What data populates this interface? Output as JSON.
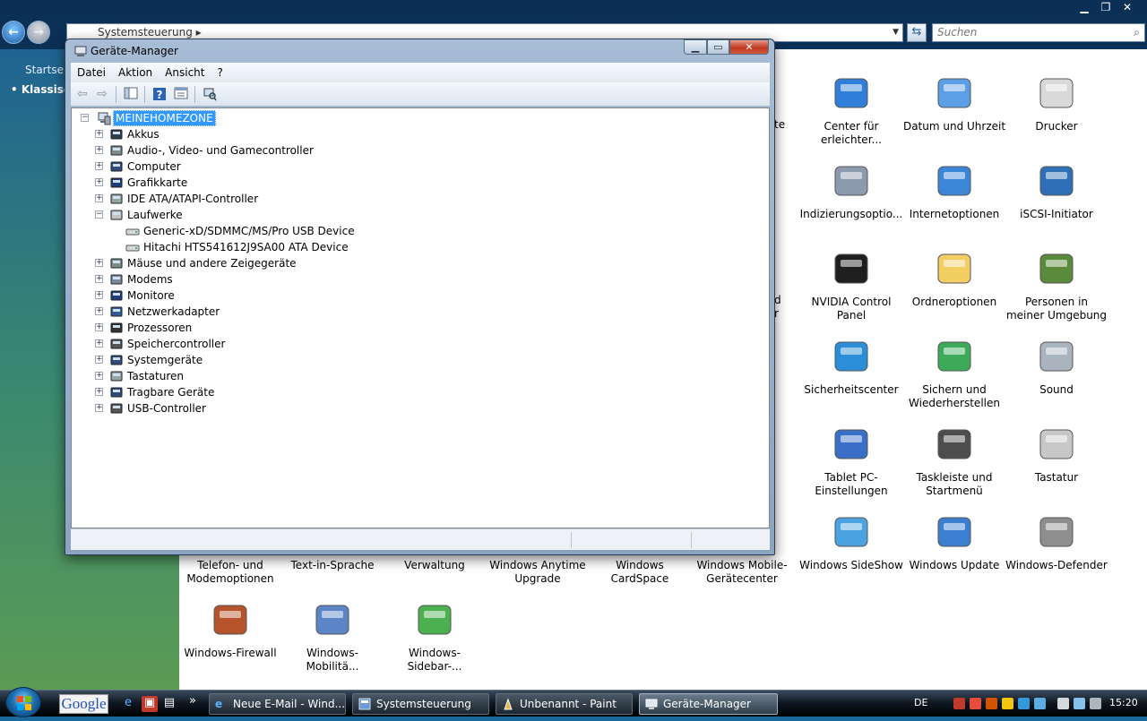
{
  "control_panel": {
    "breadcrumb": "Systemsteuerung",
    "search_placeholder": "Suchen",
    "sidebar": {
      "start": "Startseit",
      "classic": "Klassisc"
    },
    "items": [
      {
        "label": "Center für erleichter...",
        "icon": "accessibility-icon"
      },
      {
        "label": "Datum und Uhrzeit",
        "icon": "calendar-clock-icon"
      },
      {
        "label": "Drucker",
        "icon": "printer-icon"
      },
      {
        "label": "Indizierungsoptio...",
        "icon": "indexing-icon"
      },
      {
        "label": "Internetoptionen",
        "icon": "globe-icon"
      },
      {
        "label": "iSCSI-Initiator",
        "icon": "iscsi-icon"
      },
      {
        "label": "NVIDIA Control Panel",
        "icon": "nvidia-icon"
      },
      {
        "label": "Ordneroptionen",
        "icon": "folder-options-icon"
      },
      {
        "label": "Personen in meiner Umgebung",
        "icon": "people-icon"
      },
      {
        "label": "Sicherheitscenter",
        "icon": "shield-icon"
      },
      {
        "label": "Sichern und Wiederherstellen",
        "icon": "backup-icon"
      },
      {
        "label": "Sound",
        "icon": "speaker-icon"
      },
      {
        "label": "Tablet PC-Einstellungen",
        "icon": "tablet-icon"
      },
      {
        "label": "Taskleiste und Startmenü",
        "icon": "taskbar-icon"
      },
      {
        "label": "Tastatur",
        "icon": "keyboard-icon"
      },
      {
        "label": "Telefon- und Modemoptionen",
        "icon": "phone-icon"
      },
      {
        "label": "Text-in-Sprache",
        "icon": "speech-icon"
      },
      {
        "label": "Verwaltung",
        "icon": "admin-icon"
      },
      {
        "label": "Windows Anytime Upgrade",
        "icon": "upgrade-icon"
      },
      {
        "label": "Windows CardSpace",
        "icon": "cardspace-icon"
      },
      {
        "label": "Windows Mobile-Gerätecenter",
        "icon": "mobile-icon"
      },
      {
        "label": "Windows SideShow",
        "icon": "sideshow-icon"
      },
      {
        "label": "Windows Update",
        "icon": "update-icon"
      },
      {
        "label": "Windows-Defender",
        "icon": "defender-icon"
      },
      {
        "label": "Windows-Firewall",
        "icon": "firewall-icon"
      },
      {
        "label": "Windows-Mobilitä...",
        "icon": "mobility-icon"
      },
      {
        "label": "Windows-Sidebar-...",
        "icon": "sidebar-icon"
      }
    ],
    "partial_labels": [
      "te",
      "d",
      "r"
    ]
  },
  "device_manager": {
    "title": "Geräte-Manager",
    "menu": [
      "Datei",
      "Aktion",
      "Ansicht",
      "?"
    ],
    "root": "MEINEHOMEZONE",
    "categories": [
      {
        "label": "Akkus",
        "icon": "battery-icon",
        "expanded": false
      },
      {
        "label": "Audio-, Video- und Gamecontroller",
        "icon": "audio-icon",
        "expanded": false
      },
      {
        "label": "Computer",
        "icon": "computer-icon",
        "expanded": false
      },
      {
        "label": "Grafikkarte",
        "icon": "display-adapter-icon",
        "expanded": false
      },
      {
        "label": "IDE ATA/ATAPI-Controller",
        "icon": "ide-icon",
        "expanded": false
      },
      {
        "label": "Laufwerke",
        "icon": "disk-drive-icon",
        "expanded": true,
        "children": [
          "Generic-xD/SDMMC/MS/Pro  USB Device",
          "Hitachi HTS541612J9SA00 ATA Device"
        ]
      },
      {
        "label": "Mäuse und andere Zeigegeräte",
        "icon": "mouse-icon",
        "expanded": false
      },
      {
        "label": "Modems",
        "icon": "modem-icon",
        "expanded": false
      },
      {
        "label": "Monitore",
        "icon": "monitor-icon",
        "expanded": false
      },
      {
        "label": "Netzwerkadapter",
        "icon": "network-icon",
        "expanded": false
      },
      {
        "label": "Prozessoren",
        "icon": "processor-icon",
        "expanded": false
      },
      {
        "label": "Speichercontroller",
        "icon": "storage-icon",
        "expanded": false
      },
      {
        "label": "Systemgeräte",
        "icon": "system-device-icon",
        "expanded": false
      },
      {
        "label": "Tastaturen",
        "icon": "keyboard-icon",
        "expanded": false
      },
      {
        "label": "Tragbare Geräte",
        "icon": "portable-icon",
        "expanded": false
      },
      {
        "label": "USB-Controller",
        "icon": "usb-icon",
        "expanded": false
      }
    ]
  },
  "taskbar": {
    "google": "Google",
    "quicklaunch_more": "»",
    "tasks": [
      {
        "label": "Neue E-Mail - Wind...",
        "active": false
      },
      {
        "label": "Systemsteuerung",
        "active": false
      },
      {
        "label": "Unbenannt - Paint",
        "active": false
      },
      {
        "label": "Geräte-Manager",
        "active": true
      }
    ],
    "language": "DE",
    "clock": "15:20"
  },
  "colors": {
    "selection": "#3399ff",
    "close": "#c0391f",
    "taskbar": "#0d1620"
  }
}
